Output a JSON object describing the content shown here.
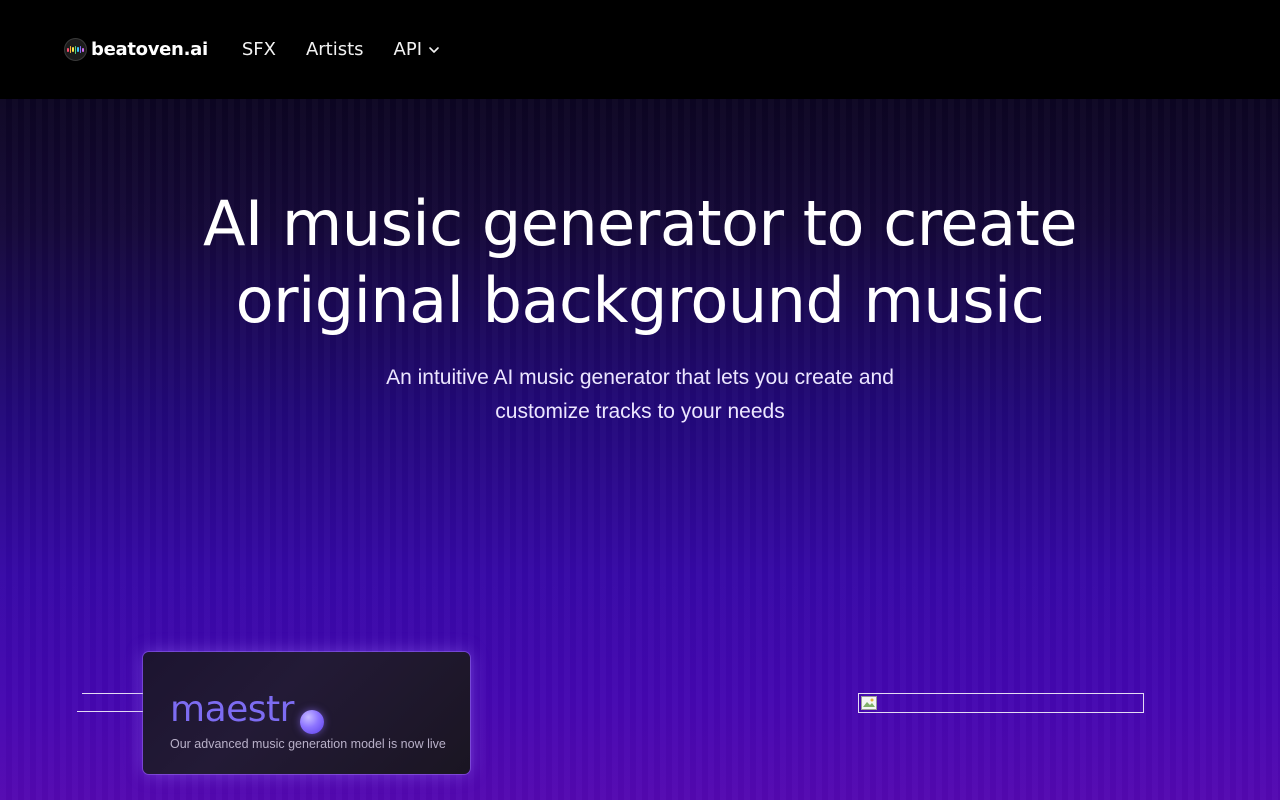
{
  "nav": {
    "brand": "beatoven.ai",
    "links": [
      {
        "label": "SFX"
      },
      {
        "label": "Artists"
      },
      {
        "label": "API",
        "has_dropdown": true
      }
    ]
  },
  "hero": {
    "title_line1": "AI music generator to create",
    "title_line2": "original background music",
    "subtitle_line1": "An intuitive AI music generator that lets you create and",
    "subtitle_line2": "customize tracks to your needs"
  },
  "maestro": {
    "word": "maestr",
    "caption": "Our advanced music generation model is now live"
  },
  "colors": {
    "accent": "#7d6cf2",
    "hero_top": "#0c0522",
    "hero_bottom": "#5408b0"
  }
}
